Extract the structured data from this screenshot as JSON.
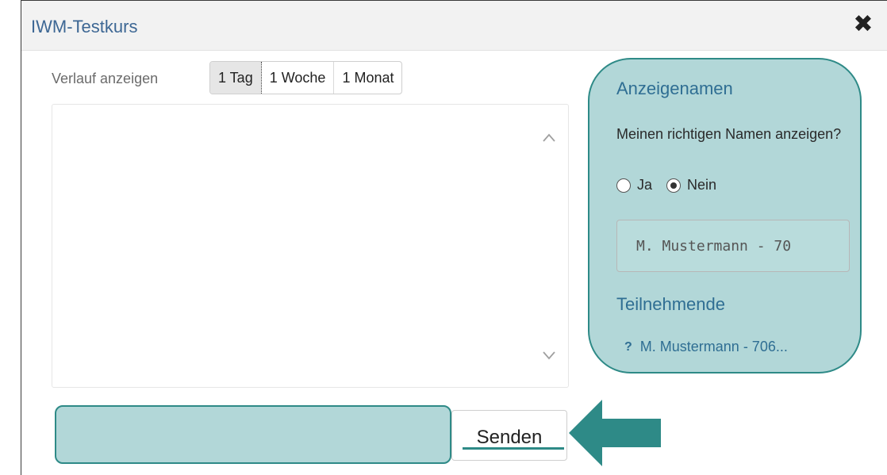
{
  "window": {
    "title": "IWM-Testkurs",
    "close_icon": "close-icon"
  },
  "history": {
    "label": "Verlauf anzeigen",
    "options": [
      "1 Tag",
      "1 Woche",
      "1 Monat"
    ],
    "selected": "1 Tag"
  },
  "side_panel": {
    "heading": "Anzeigenamen",
    "question": "Meinen richtigen Namen anzeigen?",
    "radio_yes": "Ja",
    "radio_no": "Nein",
    "selected_radio": "Nein",
    "name_value": "M. Mustermann - 70",
    "participants_heading": "Teilnehmende",
    "participants": [
      {
        "status_icon": "?",
        "name": "M. Mustermann - 706..."
      }
    ]
  },
  "composer": {
    "input_value": "",
    "send_label": "Senden"
  },
  "colors": {
    "highlight_fill": "#b2d7d8",
    "highlight_border": "#2e8a87",
    "title_blue": "#3d6794",
    "heading_blue": "#2f6e93"
  }
}
